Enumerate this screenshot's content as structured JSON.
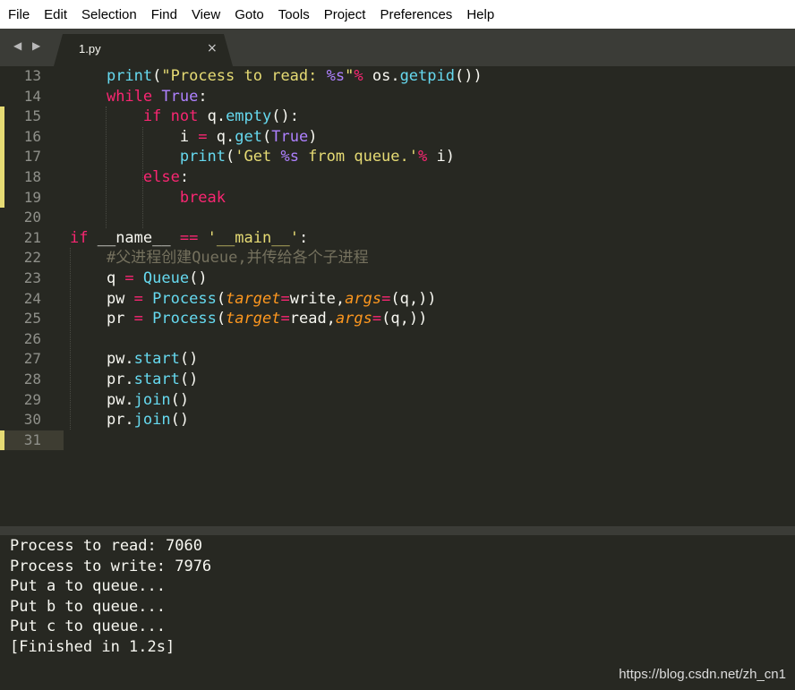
{
  "menu": [
    "File",
    "Edit",
    "Selection",
    "Find",
    "View",
    "Goto",
    "Tools",
    "Project",
    "Preferences",
    "Help"
  ],
  "nav_arrows": "◀ ▶",
  "tab": {
    "name": "1.py",
    "close_glyph": "×"
  },
  "editor": {
    "line_numbers": [
      "13",
      "14",
      "15",
      "16",
      "17",
      "18",
      "19",
      "20",
      "21",
      "22",
      "23",
      "24",
      "25",
      "26",
      "27",
      "28",
      "29",
      "30",
      "31"
    ],
    "lines": [
      [
        {
          "t": "    "
        },
        {
          "t": "print",
          "c": "fn"
        },
        {
          "t": "("
        },
        {
          "t": "\"Process to read: ",
          "c": "st"
        },
        {
          "t": "%s",
          "c": "cn"
        },
        {
          "t": "\"",
          "c": "st"
        },
        {
          "t": "%",
          "c": "kw"
        },
        {
          "t": " os."
        },
        {
          "t": "getpid",
          "c": "fn"
        },
        {
          "t": "())"
        }
      ],
      [
        {
          "t": "    "
        },
        {
          "t": "while",
          "c": "kw"
        },
        {
          "t": " "
        },
        {
          "t": "True",
          "c": "cn"
        },
        {
          "t": ":"
        }
      ],
      [
        {
          "t": "        "
        },
        {
          "t": "if",
          "c": "kw"
        },
        {
          "t": " "
        },
        {
          "t": "not",
          "c": "kw"
        },
        {
          "t": " q."
        },
        {
          "t": "empty",
          "c": "fn"
        },
        {
          "t": "():"
        }
      ],
      [
        {
          "t": "            i "
        },
        {
          "t": "=",
          "c": "kw"
        },
        {
          "t": " q."
        },
        {
          "t": "get",
          "c": "fn"
        },
        {
          "t": "("
        },
        {
          "t": "True",
          "c": "cn"
        },
        {
          "t": ")"
        }
      ],
      [
        {
          "t": "            "
        },
        {
          "t": "print",
          "c": "fn"
        },
        {
          "t": "("
        },
        {
          "t": "'Get ",
          "c": "st"
        },
        {
          "t": "%s",
          "c": "cn"
        },
        {
          "t": " from queue.'",
          "c": "st"
        },
        {
          "t": "%",
          "c": "kw"
        },
        {
          "t": " i)"
        }
      ],
      [
        {
          "t": "        "
        },
        {
          "t": "else",
          "c": "kw"
        },
        {
          "t": ":"
        }
      ],
      [
        {
          "t": "            "
        },
        {
          "t": "break",
          "c": "kw"
        }
      ],
      [],
      [
        {
          "t": "if",
          "c": "kw"
        },
        {
          "t": " __name__ "
        },
        {
          "t": "==",
          "c": "kw"
        },
        {
          "t": " "
        },
        {
          "t": "'__main__'",
          "c": "st"
        },
        {
          "t": ":"
        }
      ],
      [
        {
          "t": "    "
        },
        {
          "t": "#父进程创建Queue,并传给各个子进程",
          "c": "cm"
        }
      ],
      [
        {
          "t": "    q "
        },
        {
          "t": "=",
          "c": "kw"
        },
        {
          "t": " "
        },
        {
          "t": "Queue",
          "c": "fn"
        },
        {
          "t": "()"
        }
      ],
      [
        {
          "t": "    pw "
        },
        {
          "t": "=",
          "c": "kw"
        },
        {
          "t": " "
        },
        {
          "t": "Process",
          "c": "fn"
        },
        {
          "t": "("
        },
        {
          "t": "target",
          "c": "ar"
        },
        {
          "t": "=",
          "c": "kw"
        },
        {
          "t": "write,"
        },
        {
          "t": "args",
          "c": "ar"
        },
        {
          "t": "=",
          "c": "kw"
        },
        {
          "t": "(q,))"
        }
      ],
      [
        {
          "t": "    pr "
        },
        {
          "t": "=",
          "c": "kw"
        },
        {
          "t": " "
        },
        {
          "t": "Process",
          "c": "fn"
        },
        {
          "t": "("
        },
        {
          "t": "target",
          "c": "ar"
        },
        {
          "t": "=",
          "c": "kw"
        },
        {
          "t": "read,"
        },
        {
          "t": "args",
          "c": "ar"
        },
        {
          "t": "=",
          "c": "kw"
        },
        {
          "t": "(q,))"
        }
      ],
      [],
      [
        {
          "t": "    pw."
        },
        {
          "t": "start",
          "c": "fn"
        },
        {
          "t": "()"
        }
      ],
      [
        {
          "t": "    pr."
        },
        {
          "t": "start",
          "c": "fn"
        },
        {
          "t": "()"
        }
      ],
      [
        {
          "t": "    pw."
        },
        {
          "t": "join",
          "c": "fn"
        },
        {
          "t": "()"
        }
      ],
      [
        {
          "t": "    pr."
        },
        {
          "t": "join",
          "c": "fn"
        },
        {
          "t": "()"
        }
      ],
      []
    ],
    "modified_lines": [
      "15",
      "16",
      "17",
      "18",
      "19",
      "31"
    ],
    "current_line": "31"
  },
  "colors": {
    "background": "#272822",
    "keyword": "#f92672",
    "function": "#66d9ef",
    "string": "#e6db74",
    "constant": "#ae81ff",
    "comment": "#75715e",
    "argument": "#fd971f",
    "text": "#f8f8f2",
    "modified_marker": "#e6db74"
  },
  "console": {
    "lines": [
      "Process to read: 7060",
      "Process to write: 7976",
      "Put a to queue...",
      "Put b to queue...",
      "Put c to queue...",
      "[Finished in 1.2s]"
    ]
  },
  "watermark": "https://blog.csdn.net/zh_cn1"
}
